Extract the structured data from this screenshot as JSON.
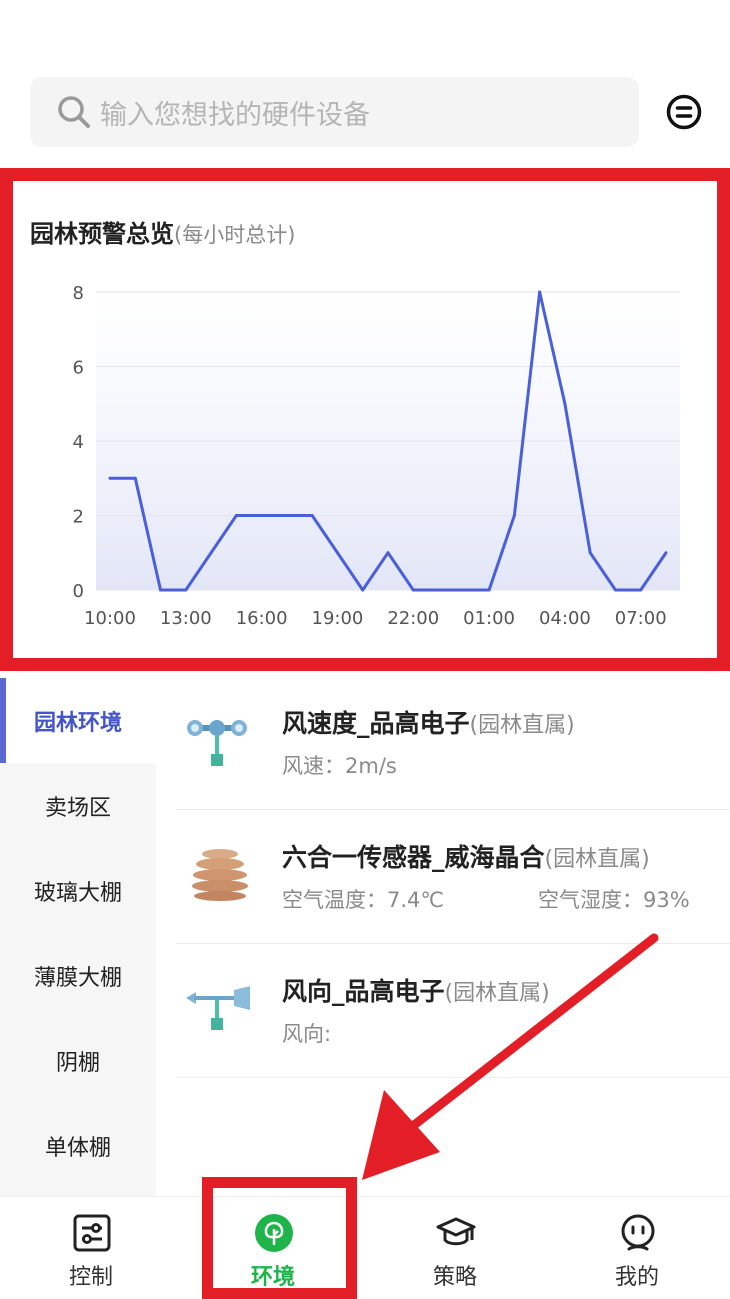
{
  "search": {
    "placeholder": "输入您想找的硬件设备",
    "icon": "search-icon"
  },
  "header": {
    "filter_icon": "filter-menu-icon"
  },
  "chart": {
    "title": "园林预警总览",
    "subtitle": "(每小时总计)"
  },
  "chart_data": {
    "type": "area",
    "title": "园林预警总览",
    "subtitle": "(每小时总计)",
    "x_tick_labels": [
      "10:00",
      "13:00",
      "16:00",
      "19:00",
      "22:00",
      "01:00",
      "04:00",
      "07:00"
    ],
    "y_tick_labels": [
      "0",
      "2",
      "4",
      "6",
      "8"
    ],
    "ylim": [
      0,
      8
    ],
    "grid": true,
    "line_color": "#4a5fd8",
    "x": [
      "10:00",
      "11:00",
      "12:00",
      "13:00",
      "14:00",
      "15:00",
      "16:00",
      "17:00",
      "18:00",
      "19:00",
      "20:00",
      "21:00",
      "22:00",
      "23:00",
      "00:00",
      "01:00",
      "02:00",
      "03:00",
      "04:00",
      "05:00",
      "06:00",
      "07:00",
      "08:00"
    ],
    "values": [
      3,
      3,
      0,
      0,
      1,
      2,
      2,
      2,
      2,
      1,
      0,
      1,
      0,
      0,
      0,
      0,
      2,
      8,
      5,
      1,
      0,
      0,
      1
    ]
  },
  "sidebar": {
    "items": [
      {
        "label": "园林环境",
        "active": true
      },
      {
        "label": "卖场区"
      },
      {
        "label": "玻璃大棚"
      },
      {
        "label": "薄膜大棚"
      },
      {
        "label": "阴棚"
      },
      {
        "label": "单体棚"
      }
    ]
  },
  "devices": [
    {
      "name": "风速度_品高电子",
      "owner": "(园林直属)",
      "reading1": "风速：2m/s",
      "icon": "anemometer-icon"
    },
    {
      "name": "六合一传感器_威海晶合",
      "owner": "(园林直属)",
      "reading1": "空气温度：7.4℃",
      "reading2": "空气湿度：93%",
      "icon": "six-in-one-sensor-icon"
    },
    {
      "name": "风向_品高电子",
      "owner": "(园林直属)",
      "reading1": "风向:",
      "icon": "wind-vane-icon"
    }
  ],
  "nav": {
    "items": [
      {
        "label": "控制",
        "icon": "sliders-icon"
      },
      {
        "label": "环境",
        "icon": "tree-icon",
        "active": true
      },
      {
        "label": "策略",
        "icon": "graduation-cap-icon"
      },
      {
        "label": "我的",
        "icon": "smiley-icon"
      }
    ]
  },
  "colors": {
    "accent": "#1fb44a",
    "highlight": "#e41e26",
    "sidebar_active": "#4355c9"
  }
}
